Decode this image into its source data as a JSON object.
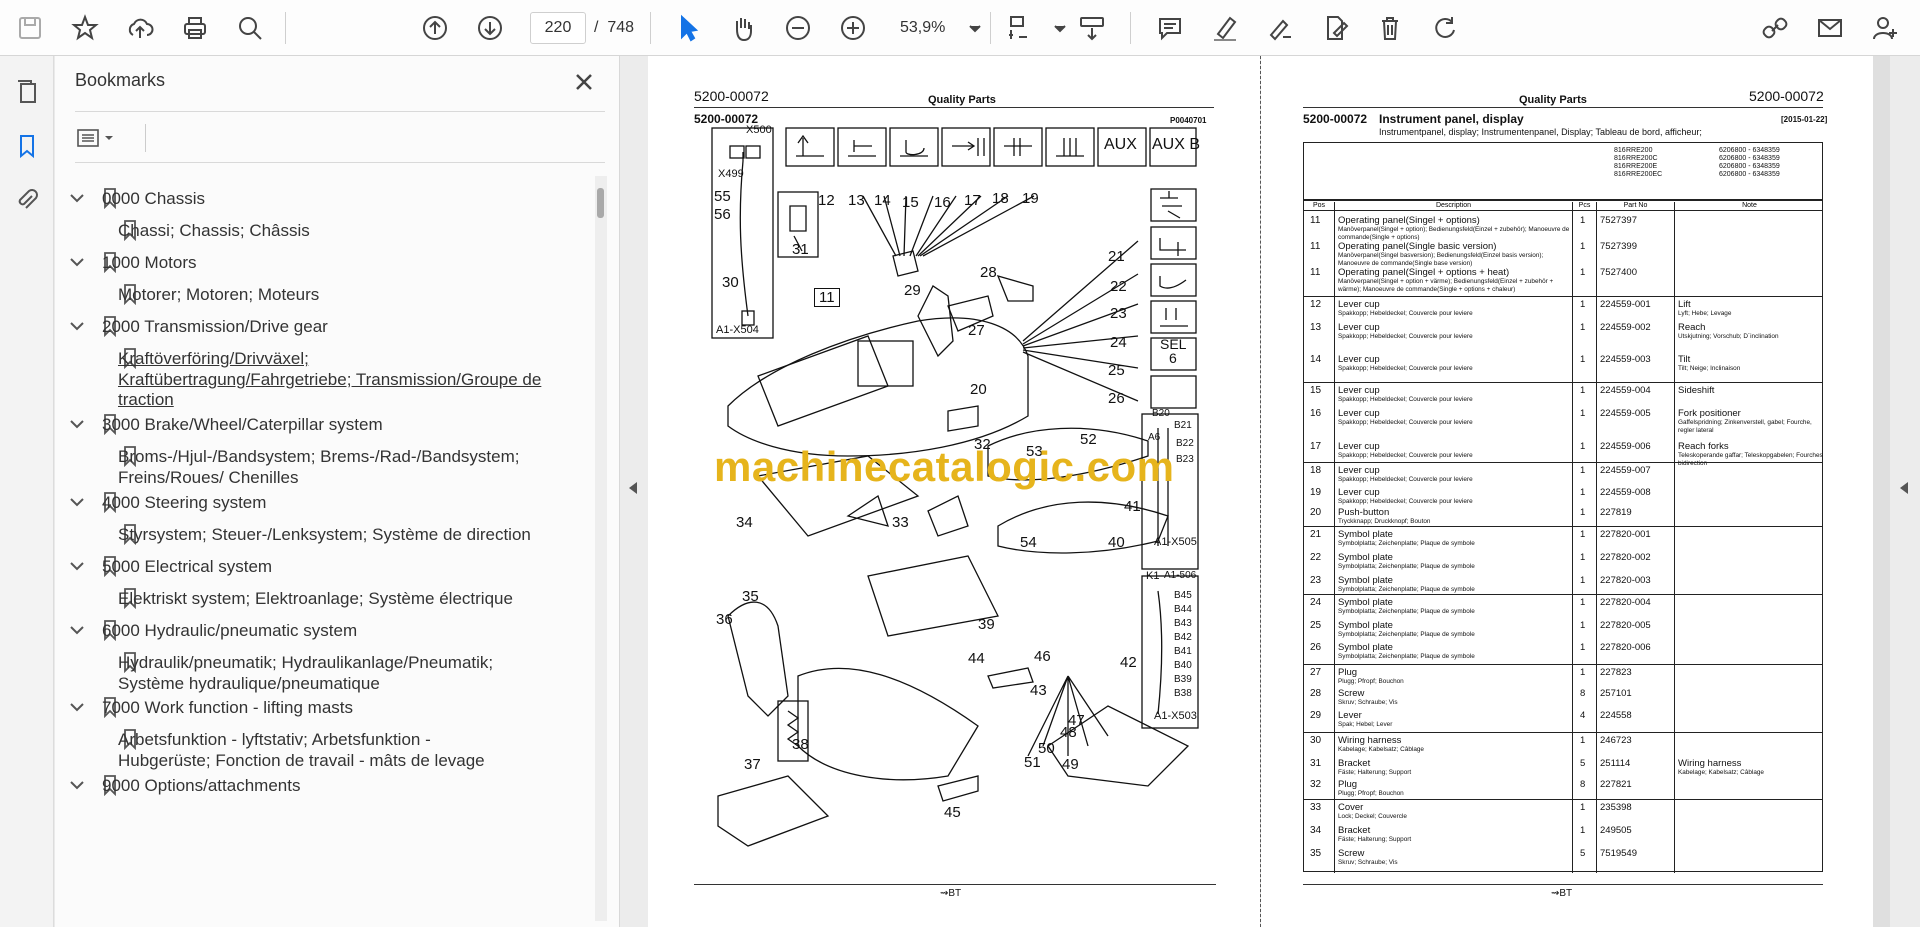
{
  "toolbar": {
    "page_current": "220",
    "page_separator": "/",
    "page_total": "748",
    "zoom": "53,9%"
  },
  "bookmarks": {
    "title": "Bookmarks",
    "items": [
      {
        "label": "0000 Chassis",
        "level": 0
      },
      {
        "label": "Chassi; Chassis; Châssis",
        "level": 1
      },
      {
        "label": "1000 Motors",
        "level": 0
      },
      {
        "label": "Motorer; Motoren; Moteurs",
        "level": 1
      },
      {
        "label": "2000 Transmission/Drive gear",
        "level": 0
      },
      {
        "label": "Kraftöverföring/Drivväxel;",
        "level": 1
      },
      {
        "label": "Kraftübertragung/Fahrgetriebe; Transmission/Groupe de",
        "level": 1
      },
      {
        "label": "traction",
        "level": 1
      },
      {
        "label": "3000 Brake/Wheel/Caterpillar system",
        "level": 0
      },
      {
        "label": "Broms-/Hjul-/Bandsystem; Brems-/Rad-/Bandsystem;",
        "level": 1
      },
      {
        "label": "Freins/Roues/ Chenilles",
        "level": 1
      },
      {
        "label": "4000 Steering system",
        "level": 0
      },
      {
        "label": "Styrsystem; Steuer-/Lenksystem; Système de direction",
        "level": 1
      },
      {
        "label": "5000 Electrical system",
        "level": 0
      },
      {
        "label": "Elektriskt system; Elektroanlage; Système électrique",
        "level": 1
      },
      {
        "label": "6000 Hydraulic/pneumatic system",
        "level": 0
      },
      {
        "label": "Hydraulik/pneumatik; Hydraulikanlage/Pneumatik;",
        "level": 1
      },
      {
        "label": "Système hydraulique/pneumatique",
        "level": 1
      },
      {
        "label": "7000 Work function - lifting masts",
        "level": 0
      },
      {
        "label": "Arbetsfunktion - lyftstativ; Arbetsfunktion -",
        "level": 1
      },
      {
        "label": "Hubgerüste; Fonction de travail - mâts de levage",
        "level": 1
      },
      {
        "label": "9000 Options/attachments",
        "level": 0
      }
    ]
  },
  "left_page": {
    "header_code": "5200-00072",
    "header_center": "Quality Parts",
    "sub_code": "5200-00072",
    "figure_ref": "P0040701",
    "footer": "BT",
    "callouts": [
      "12",
      "13",
      "14",
      "15",
      "16",
      "17",
      "18",
      "19",
      "21",
      "22",
      "23",
      "24",
      "25",
      "26",
      "28",
      "29",
      "27",
      "20",
      "11",
      "31",
      "30",
      "55",
      "56",
      "32",
      "53",
      "52",
      "41",
      "40",
      "54",
      "33",
      "34",
      "35",
      "36",
      "39",
      "44",
      "46",
      "43",
      "47",
      "48",
      "50",
      "51",
      "49",
      "45",
      "38",
      "37",
      "42"
    ],
    "connectors": {
      "x499": "X499",
      "x500": "X500",
      "a1x504": "A1-X504",
      "a1x505": "A1-X505",
      "a1x503": "A1-X503",
      "a1506": "A1-506",
      "b20": "B20",
      "b21": "B21",
      "a6": "A6",
      "b22": "B22",
      "b23": "B23",
      "k1": "K1",
      "b45": "B45",
      "b44": "B44",
      "b43": "B43",
      "b42": "B42",
      "b41": "B41",
      "b40": "B40",
      "b39": "B39",
      "b38": "B38"
    },
    "symbol_aux": "AUX",
    "symbol_auxb": "AUX B",
    "symbol_sel": "SEL",
    "symbol_sel_num": "6"
  },
  "watermark": "machinecatalogic.com",
  "right_page": {
    "header_code": "5200-00072",
    "header_center": "Quality Parts",
    "title_code": "5200-00072",
    "title": "Instrument panel, display",
    "subtitle": "Instrumentpanel, display; Instrumentenpanel, Display; Tableau de bord, afficheur;",
    "date": "[2015-01-22]",
    "models": [
      [
        "816",
        "RRE200",
        "6206800 - 6348359"
      ],
      [
        "816",
        "RRE200C",
        "6206800 - 6348359"
      ],
      [
        "816",
        "RRE200E",
        "6206800 - 6348359"
      ],
      [
        "816",
        "RRE200EC",
        "6206800 - 6348359"
      ]
    ],
    "columns": [
      "Pos",
      "Description",
      "Pcs",
      "Part No",
      "Note"
    ],
    "rows": [
      {
        "pos": "11",
        "desc": "Operating panel(Singel + options)",
        "sub": "Manöverpanel(Singel + option); Bedienungsfeld(Einzel + zubehör); Manoeuvre de commande(Single + options)",
        "pcs": "1",
        "part": "7527397",
        "note": ""
      },
      {
        "pos": "11",
        "desc": "Operating panel(Single basic version)",
        "sub": "Manöverpanel(Singel basversion); Bedienungsfeld(Einzel basis version); Manoeuvre de commande(Single base version)",
        "pcs": "1",
        "part": "7527399",
        "note": ""
      },
      {
        "pos": "11",
        "desc": "Operating panel(Singel + options + heat)",
        "sub": "Manöverpanel(Singel + option + värme); Bedienungsfeld(Einzel + zubehör + wärme); Manoeuvre de commande(Single + options + chaleur)",
        "pcs": "1",
        "part": "7527400",
        "note": ""
      },
      {
        "pos": "12",
        "desc": "Lever cup",
        "sub": "Spakkopp; Hebeldeckel; Couvercle pour leviere",
        "pcs": "1",
        "part": "224559-001",
        "note": "Lift",
        "note_sub": "Lyft; Hebe; Levage"
      },
      {
        "pos": "13",
        "desc": "Lever cup",
        "sub": "Spakkopp; Hebeldeckel; Couvercle pour leviere",
        "pcs": "1",
        "part": "224559-002",
        "note": "Reach",
        "note_sub": "Utskjutning; Vorschub; D´inclination"
      },
      {
        "pos": "14",
        "desc": "Lever cup",
        "sub": "Spakkopp; Hebeldeckel; Couvercle pour leviere",
        "pcs": "1",
        "part": "224559-003",
        "note": "Tilt",
        "note_sub": "Tilt; Neige; Inclinaison"
      },
      {
        "pos": "15",
        "desc": "Lever cup",
        "sub": "Spakkopp; Hebeldeckel; Couvercle pour leviere",
        "pcs": "1",
        "part": "224559-004",
        "note": "Sideshift",
        "note_sub": ""
      },
      {
        "pos": "16",
        "desc": "Lever cup",
        "sub": "Spakkopp; Hebeldeckel; Couvercle pour leviere",
        "pcs": "1",
        "part": "224559-005",
        "note": "Fork positioner",
        "note_sub": "Gaffelspridning; Zinkenverstell, gabel; Fourche, regler lateral"
      },
      {
        "pos": "17",
        "desc": "Lever cup",
        "sub": "Spakkopp; Hebeldeckel; Couvercle pour leviere",
        "pcs": "1",
        "part": "224559-006",
        "note": "Reach forks",
        "note_sub": "Teleskoperande gaffar; Teleskopgabelen; Fourches bidirection"
      },
      {
        "pos": "18",
        "desc": "Lever cup",
        "sub": "Spakkopp; Hebeldeckel; Couvercle pour leviere",
        "pcs": "1",
        "part": "224559-007",
        "note": ""
      },
      {
        "pos": "19",
        "desc": "Lever cup",
        "sub": "Spakkopp; Hebeldeckel; Couvercle pour leviere",
        "pcs": "1",
        "part": "224559-008",
        "note": ""
      },
      {
        "pos": "20",
        "desc": "Push-button",
        "sub": "Tryckknapp; Druckknopf; Bouton",
        "pcs": "1",
        "part": "227819",
        "note": ""
      },
      {
        "pos": "21",
        "desc": "Symbol plate",
        "sub": "Symbolplatta; Zeichenplatte; Plaque de symbole",
        "pcs": "1",
        "part": "227820-001",
        "note": ""
      },
      {
        "pos": "22",
        "desc": "Symbol plate",
        "sub": "Symbolplatta; Zeichenplatte; Plaque de symbole",
        "pcs": "1",
        "part": "227820-002",
        "note": ""
      },
      {
        "pos": "23",
        "desc": "Symbol plate",
        "sub": "Symbolplatta; Zeichenplatte; Plaque de symbole",
        "pcs": "1",
        "part": "227820-003",
        "note": ""
      },
      {
        "pos": "24",
        "desc": "Symbol plate",
        "sub": "Symbolplatta; Zeichenplatte; Plaque de symbole",
        "pcs": "1",
        "part": "227820-004",
        "note": ""
      },
      {
        "pos": "25",
        "desc": "Symbol plate",
        "sub": "Symbolplatta; Zeichenplatte; Plaque de symbole",
        "pcs": "1",
        "part": "227820-005",
        "note": ""
      },
      {
        "pos": "26",
        "desc": "Symbol plate",
        "sub": "Symbolplatta; Zeichenplatte; Plaque de symbole",
        "pcs": "1",
        "part": "227820-006",
        "note": ""
      },
      {
        "pos": "27",
        "desc": "Plug",
        "sub": "Plugg; Pfropf; Bouchon",
        "pcs": "1",
        "part": "227823",
        "note": ""
      },
      {
        "pos": "28",
        "desc": "Screw",
        "sub": "Skruv; Schraube; Vis",
        "pcs": "8",
        "part": "257101",
        "note": ""
      },
      {
        "pos": "29",
        "desc": "Lever",
        "sub": "Spak; Hebel; Lever",
        "pcs": "4",
        "part": "224558",
        "note": ""
      },
      {
        "pos": "30",
        "desc": "Wiring harness",
        "sub": "Kabelage; Kabelsatz; Câblage",
        "pcs": "1",
        "part": "246723",
        "note": ""
      },
      {
        "pos": "31",
        "desc": "Bracket",
        "sub": "Fäste; Halterung; Support",
        "pcs": "5",
        "part": "251114",
        "note": "Wiring harness",
        "note_sub": "Kabelage; Kabelsatz; Câblage"
      },
      {
        "pos": "32",
        "desc": "Plug",
        "sub": "Plugg; Pfropf; Bouchon",
        "pcs": "8",
        "part": "227821",
        "note": ""
      },
      {
        "pos": "33",
        "desc": "Cover",
        "sub": "Lock; Deckel; Couvercle",
        "pcs": "1",
        "part": "235398",
        "note": ""
      },
      {
        "pos": "34",
        "desc": "Bracket",
        "sub": "Fäste; Halterung; Support",
        "pcs": "1",
        "part": "249505",
        "note": ""
      },
      {
        "pos": "35",
        "desc": "Screw",
        "sub": "Skruv; Schraube; Vis",
        "pcs": "5",
        "part": "7519549",
        "note": ""
      }
    ],
    "footer": "BT"
  }
}
